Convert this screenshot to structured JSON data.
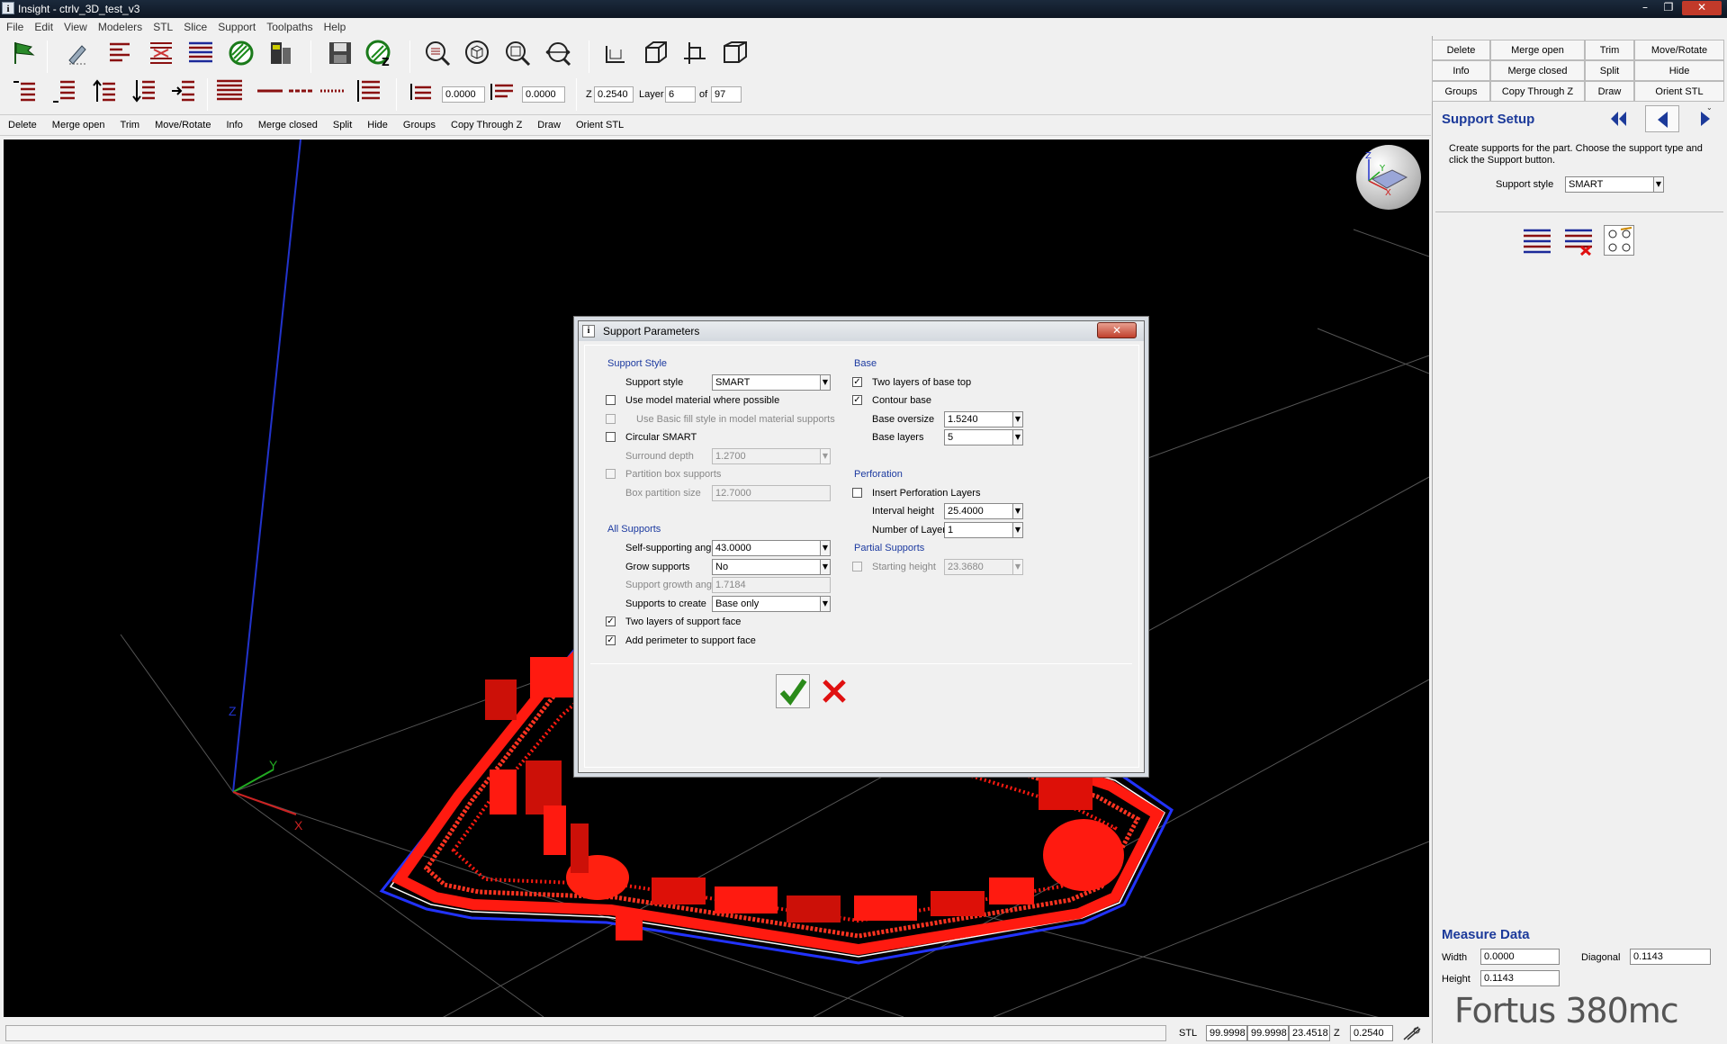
{
  "window": {
    "title": "Insight - ctrlv_3D_test_v3"
  },
  "menu": [
    "File",
    "Edit",
    "View",
    "Modelers",
    "STL",
    "Slice",
    "Support",
    "Toolpaths",
    "Help"
  ],
  "toolbar2": {
    "offset1": "0.0000",
    "offset2": "0.0000",
    "z_label": "Z",
    "z_value": "0.2540",
    "layer_label": "Layer",
    "layer_value": "6",
    "of_label": "of",
    "of_value": "97"
  },
  "command_bar": [
    "Delete",
    "Merge open",
    "Trim",
    "Move/Rotate",
    "Info",
    "Merge closed",
    "Split",
    "Hide",
    "Groups",
    "Copy Through Z",
    "Draw",
    "Orient STL"
  ],
  "right_buttons": [
    "Delete",
    "Merge open",
    "Trim",
    "Move/Rotate",
    "Info",
    "Merge closed",
    "Split",
    "Hide",
    "Groups",
    "Copy Through Z",
    "Draw",
    "Orient STL"
  ],
  "support_setup": {
    "title": "Support Setup",
    "description": "Create supports for the part. Choose the support type and click the Support button.",
    "style_label": "Support style",
    "style_value": "SMART"
  },
  "measure": {
    "title": "Measure Data",
    "width_label": "Width",
    "width_value": "0.0000",
    "diagonal_label": "Diagonal",
    "diagonal_value": "0.1143",
    "height_label": "Height",
    "height_value": "0.1143"
  },
  "brand": "Fortus 380mc",
  "status": {
    "stl_label": "STL",
    "v1": "99.9998",
    "v2": "99.9998",
    "v3": "23.4518",
    "z_label": "Z",
    "z_value": "0.2540"
  },
  "viewport": {
    "axis_z": "Z",
    "axis_y": "Y",
    "axis_x": "X"
  },
  "dialog": {
    "title": "Support Parameters",
    "support_style": {
      "heading": "Support Style",
      "style_label": "Support style",
      "style_value": "SMART",
      "model_material": "Use model material where possible",
      "model_material_checked": false,
      "basic_fill": "Use Basic fill style in model material supports",
      "basic_fill_checked": false,
      "circular": "Circular SMART",
      "circular_checked": false,
      "surround_label": "Surround depth",
      "surround_value": "1.2700",
      "partition": "Partition box supports",
      "partition_checked": false,
      "box_label": "Box partition size",
      "box_value": "12.7000"
    },
    "all_supports": {
      "heading": "All Supports",
      "angle_label": "Self-supporting angle",
      "angle_value": "43.0000",
      "grow_label": "Grow supports",
      "grow_value": "No",
      "growth_label": "Support growth angle",
      "growth_value": "1.7184",
      "create_label": "Supports to create",
      "create_value": "Base only",
      "two_layers": "Two layers of support face",
      "two_layers_checked": true,
      "perimeter": "Add perimeter to support face",
      "perimeter_checked": true
    },
    "base": {
      "heading": "Base",
      "two_layers_top": "Two layers of base top",
      "two_layers_top_checked": true,
      "contour": "Contour base",
      "contour_checked": true,
      "oversize_label": "Base oversize",
      "oversize_value": "1.5240",
      "layers_label": "Base layers",
      "layers_value": "5"
    },
    "perforation": {
      "heading": "Perforation",
      "insert": "Insert Perforation Layers",
      "insert_checked": false,
      "interval_label": "Interval height",
      "interval_value": "25.4000",
      "number_label": "Number of Layers",
      "number_value": "1"
    },
    "partial": {
      "heading": "Partial Supports",
      "start_label": "Starting height",
      "start_checked": false,
      "start_value": "23.3680"
    }
  },
  "colors": {
    "accent_blue": "#1c3a9a",
    "part_red": "#ff1a10",
    "ok_green": "#2a8a1a",
    "cancel_red": "#e01010"
  }
}
